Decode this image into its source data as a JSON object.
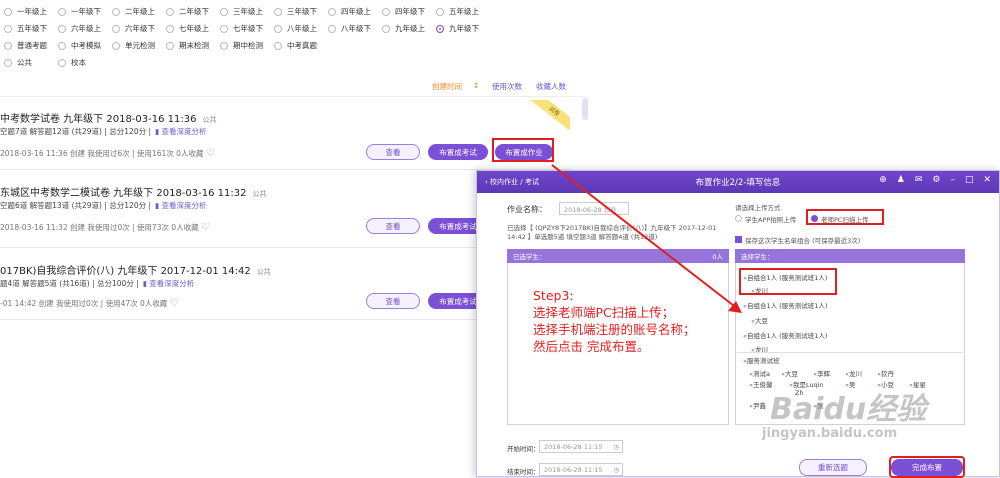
{
  "grades": {
    "rows": [
      [
        "一年级上",
        "一年级下",
        "二年级上",
        "二年级下",
        "三年级上",
        "三年级下",
        "四年级上",
        "四年级下",
        "五年级上"
      ],
      [
        "五年级下",
        "六年级上",
        "六年级下",
        "七年级上",
        "七年级下",
        "八年级上",
        "八年级下",
        "九年级上",
        "九年级下"
      ],
      [
        "普通考题",
        "中考模拟",
        "单元检测",
        "期末检测",
        "期中检测",
        "中考真题"
      ],
      [
        "公共",
        "校本"
      ]
    ],
    "selected": "九年级下"
  },
  "sortbar": {
    "created": "创建时间",
    "used": "使用次数",
    "favorites": "收藏人数"
  },
  "cards": [
    {
      "title": "中考数学试卷 九年级下 2018-03-16 11:36",
      "pub": "公共",
      "stats": "空题7道  解答题12道 (共29道)  |  总分120分  |",
      "analysis": "查看深度分析",
      "meta": "2018-03-16 11:36 创建    我使用过6次    |   使用161次    0人收藏",
      "ribbon": "试卷",
      "view": "查看",
      "exam": "布置成考试",
      "homework": "布置成作业"
    },
    {
      "title": "东城区中考数学二模试卷 九年级下 2018-03-16 11:32",
      "pub": "公共",
      "stats": "空题6道  解答题13道 (共29道)  |  总分120分  |",
      "analysis": "查看深度分析",
      "meta": "2018-03-16 11:32 创建    我使用过0次    |   使用73次    0人收藏",
      "view": "查看",
      "exam": "布置成考试"
    },
    {
      "title": "017BK)自我综合评价(八) 九年级下 2017-12-01 14:42",
      "pub": "公共",
      "stats": "题4道  解答题5道 (共16道)  |  总分100分  |",
      "analysis": "查看深度分析",
      "meta": "-01 14:42 创建    我使用过0次    |   使用47次    0人收藏",
      "view": "查看",
      "exam": "布置成考试"
    }
  ],
  "dialog": {
    "back": "校内作业 / 考试",
    "title": "布置作业2/2-填写信息",
    "name_label": "作业名称：",
    "name_value": "2018-06-28 作业",
    "selected_info": "已选择【 (QPZY8下2017BK)自我综合评价(八)】九年级下 2017-12-01 14:42 】单选题5道 填空题3道 解答题4道 (共12道)",
    "upload_label": "请选择上传方式",
    "upload_opt1": "学生APP拍照上传",
    "upload_opt2": "老师PC扫描上传",
    "save_label": "保存这次学生名单组合 (可保存最近3次)",
    "selected_students": "已选学生：",
    "selected_count": "0人",
    "choose_students": "选择学生：",
    "groups": [
      "自组合1人 (服务测试班1人)",
      "龙川",
      "自组合1人 (服务测试班1人)",
      "大豆",
      "自组合1人 (服务测试班1人)",
      "龙川"
    ],
    "class_name": "服务测试班",
    "students": [
      "测试a",
      "大豆",
      "李辉",
      "龙川",
      "钦丹",
      "王俊馨",
      "我是Luqin",
      "吴",
      "小豆",
      "星星",
      "Zh",
      "尹鑫",
      "张"
    ],
    "start_label": "开始时间：",
    "start_value": "2018-06-28 11:15",
    "end_label": "结束时间：",
    "end_value": "2018-06-28 11:15",
    "reselect": "重新选题",
    "finish": "完成布置"
  },
  "annotation": {
    "line1": "Step3:",
    "line2": "选择老师端PC扫描上传；",
    "line3": "选择手机端注册的账号名称；",
    "line4": "然后点击 完成布置。"
  },
  "watermark": {
    "brand": "Baidu经验",
    "url": "jingyan.baidu.com"
  },
  "colors": {
    "accent": "#7b4fd6",
    "annotation": "#e41e1e",
    "link_orange": "#f08a24"
  }
}
